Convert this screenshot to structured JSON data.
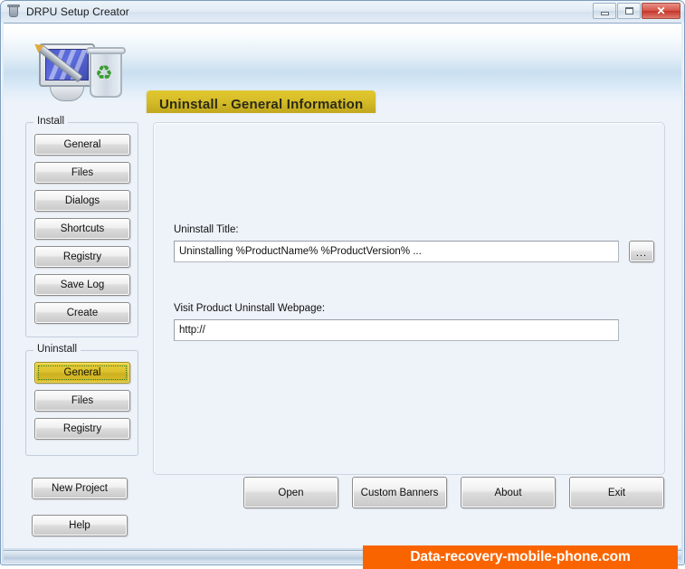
{
  "window": {
    "title": "DRPU Setup Creator",
    "icon": "recycle-bin-icon",
    "controls": {
      "minimize": "–",
      "maximize": "□",
      "close": "✕"
    }
  },
  "header": {
    "logo_icon": "monitor-pen-recyclebin-icon",
    "banner_title": "Uninstall - General Information",
    "banner_color": "#d6bc28"
  },
  "sidebar": {
    "install_group": {
      "legend": "Install",
      "buttons": [
        {
          "label": "General",
          "active": false
        },
        {
          "label": "Files",
          "active": false
        },
        {
          "label": "Dialogs",
          "active": false
        },
        {
          "label": "Shortcuts",
          "active": false
        },
        {
          "label": "Registry",
          "active": false
        },
        {
          "label": "Save Log",
          "active": false
        },
        {
          "label": "Create",
          "active": false
        }
      ]
    },
    "uninstall_group": {
      "legend": "Uninstall",
      "buttons": [
        {
          "label": "General",
          "active": true
        },
        {
          "label": "Files",
          "active": false
        },
        {
          "label": "Registry",
          "active": false
        }
      ]
    },
    "lower_buttons": [
      {
        "label": "New Project"
      },
      {
        "label": "Help"
      }
    ]
  },
  "main": {
    "fields": [
      {
        "label": "Uninstall Title:",
        "value": "Uninstalling %ProductName% %ProductVersion% ...",
        "has_browse": true,
        "browse_label": "..."
      },
      {
        "label": "Visit Product Uninstall Webpage:",
        "value": "http://",
        "has_browse": false
      }
    ]
  },
  "actions": [
    {
      "label": "Open"
    },
    {
      "label": "Custom Banners"
    },
    {
      "label": "About"
    },
    {
      "label": "Exit"
    }
  ],
  "watermark": {
    "text": "Data-recovery-mobile-phone.com",
    "background": "#fa6400",
    "color": "#ffffff"
  }
}
